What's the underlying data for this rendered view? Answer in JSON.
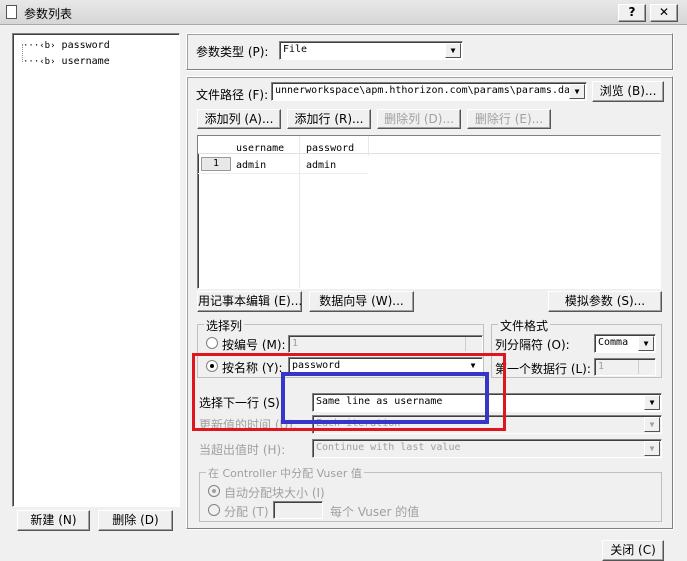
{
  "window": {
    "title": "参数列表",
    "help": "?",
    "close": "✕"
  },
  "tree": {
    "items": [
      "password",
      "username"
    ]
  },
  "left_buttons": {
    "new": "新建 (N)",
    "delete": "删除 (D)"
  },
  "param_type": {
    "label": "参数类型 (P):",
    "value": "File"
  },
  "file_path": {
    "label": "文件路径 (F):",
    "value": "unnerworkspace\\apm.hthorizon.com\\params\\params.dat",
    "browse": "浏览 (B)..."
  },
  "row_buttons": {
    "add_col": "添加列 (A)...",
    "add_row": "添加行 (R)...",
    "del_col": "删除列 (D)...",
    "del_row": "删除行 (E)..."
  },
  "table": {
    "columns": [
      "username",
      "password"
    ],
    "rows": [
      {
        "num": "1",
        "cells": [
          "admin",
          "admin"
        ]
      }
    ]
  },
  "bottom_buttons": {
    "notepad": "用记事本编辑 (E)...",
    "wizard": "数据向导 (W)...",
    "simulate": "模拟参数 (S)..."
  },
  "select_column": {
    "title": "选择列",
    "by_number": "按编号 (M):",
    "number_value": "1",
    "by_name": "按名称 (Y):",
    "name_value": "password",
    "selected": "by_name"
  },
  "file_format": {
    "title": "文件格式",
    "delimiter_label": "列分隔符 (O):",
    "delimiter_value": "Comma",
    "first_row_label": "第一个数据行 (L):",
    "first_row_value": "1"
  },
  "select_next_row": {
    "label": "选择下一行 (S):",
    "value": "Same line as username"
  },
  "update_value": {
    "label": "更新值的时间 (U):",
    "value": "Each iteration"
  },
  "out_of_values": {
    "label": "当超出值时 (H):",
    "value": "Continue with last value"
  },
  "controller": {
    "title": "在 Controller 中分配 Vuser 值",
    "auto": "自动分配块大小 (I)",
    "allocate": "分配 (T)",
    "per_vuser": "每个 Vuser 的值"
  },
  "close_button": "关闭 (C)",
  "annotations": {
    "red": "#e0161e",
    "blue": "#3636c8"
  }
}
